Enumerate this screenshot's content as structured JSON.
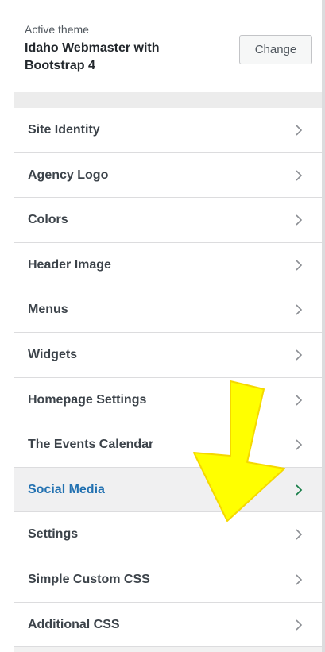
{
  "theme": {
    "label": "Active theme",
    "name": "Idaho Webmaster with Bootstrap 4",
    "change_label": "Change"
  },
  "menu": {
    "items": [
      {
        "label": "Site Identity",
        "active": false
      },
      {
        "label": "Agency Logo",
        "active": false
      },
      {
        "label": "Colors",
        "active": false
      },
      {
        "label": "Header Image",
        "active": false
      },
      {
        "label": "Menus",
        "active": false
      },
      {
        "label": "Widgets",
        "active": false
      },
      {
        "label": "Homepage Settings",
        "active": false
      },
      {
        "label": "The Events Calendar",
        "active": false
      },
      {
        "label": "Social Media",
        "active": true
      },
      {
        "label": "Settings",
        "active": false
      },
      {
        "label": "Simple Custom CSS",
        "active": false
      },
      {
        "label": "Additional CSS",
        "active": false
      }
    ]
  },
  "colors": {
    "accent": "#2271b1",
    "chevron": "#8c8f94",
    "chevron_active": "#1a7f4b",
    "annotation_arrow": "#ffff00"
  },
  "icons": {
    "chevron": "chevron-right-icon",
    "annotation": "arrow-down-annotation-icon"
  }
}
